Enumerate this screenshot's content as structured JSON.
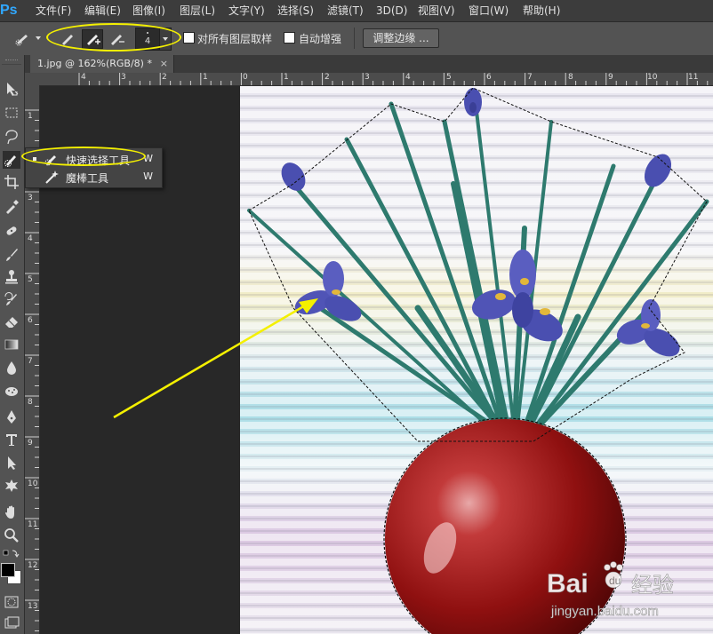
{
  "app": {
    "logo": "Ps"
  },
  "menu": [
    {
      "label": "文件(F)"
    },
    {
      "label": "编辑(E)"
    },
    {
      "label": "图像(I)"
    },
    {
      "label": "图层(L)"
    },
    {
      "label": "文字(Y)"
    },
    {
      "label": "选择(S)"
    },
    {
      "label": "滤镜(T)"
    },
    {
      "label": "3D(D)"
    },
    {
      "label": "视图(V)"
    },
    {
      "label": "窗口(W)"
    },
    {
      "label": "帮助(H)"
    }
  ],
  "options": {
    "brush_size": "4",
    "sample_all_layers_label": "对所有图层取样",
    "sample_all_layers_checked": false,
    "auto_enhance_label": "自动增强",
    "auto_enhance_checked": false,
    "refine_edge_label": "调整边缘 ..."
  },
  "document": {
    "tab_title": "1.jpg @ 162%(RGB/8) *",
    "close_glyph": "×"
  },
  "rulers": {
    "top_ticks": [
      "4",
      "3",
      "2",
      "1",
      "0",
      "1",
      "2",
      "3",
      "4",
      "5",
      "6",
      "7",
      "8",
      "9",
      "10",
      "11"
    ],
    "left_ticks": [
      "1",
      "2",
      "3",
      "4",
      "5",
      "6",
      "7",
      "8",
      "9",
      "10",
      "11",
      "12",
      "13"
    ]
  },
  "flyout": {
    "items": [
      {
        "label": "快速选择工具",
        "shortcut": "W",
        "selected": true
      },
      {
        "label": "魔棒工具",
        "shortcut": "W",
        "selected": false
      }
    ]
  },
  "watermark": {
    "brand": "Bai",
    "brand_cn": "经验",
    "site": "jingyan.baidu.com"
  },
  "colors": {
    "annotation": "#f4f000",
    "accent": "#31a8ff",
    "vase": "#8f1010",
    "flower": "#4a4fb0"
  }
}
